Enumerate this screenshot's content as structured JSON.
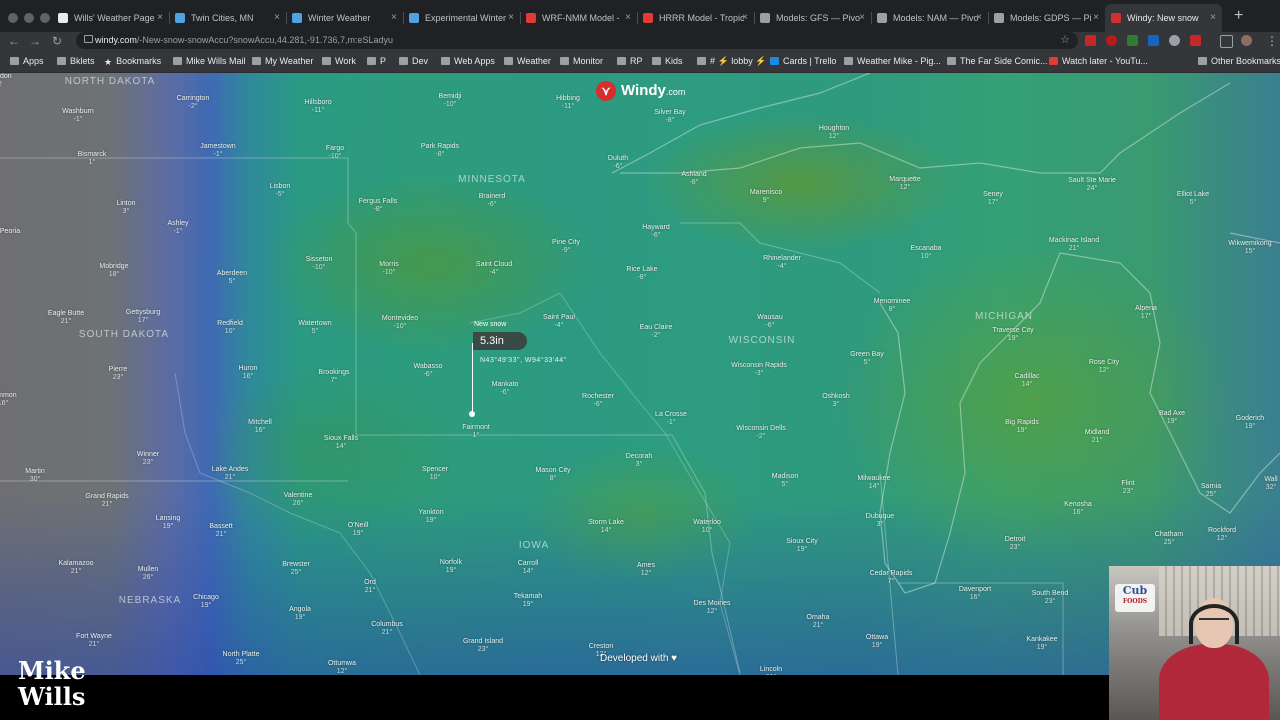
{
  "browser": {
    "tabs": [
      {
        "title": "Wills' Weather Page",
        "favicon_color": "#e8eaed",
        "active": false
      },
      {
        "title": "Twin Cities, MN",
        "favicon_color": "#4fa3e0",
        "active": false
      },
      {
        "title": "Winter Weather",
        "favicon_color": "#4fa3e0",
        "active": false
      },
      {
        "title": "Experimental Winter",
        "favicon_color": "#4fa3e0",
        "active": false
      },
      {
        "title": "WRF-NMM Model - ",
        "favicon_color": "#e53935",
        "active": false
      },
      {
        "title": "HRRR Model - Tropic",
        "favicon_color": "#e53935",
        "active": false
      },
      {
        "title": "Models: GFS — Pivo",
        "favicon_color": "#9aa0a6",
        "active": false
      },
      {
        "title": "Models: NAM — Pivo",
        "favicon_color": "#9aa0a6",
        "active": false
      },
      {
        "title": "Models: GDPS — Pi",
        "favicon_color": "#9aa0a6",
        "active": false
      },
      {
        "title": "Windy: New snow",
        "favicon_color": "#d32f2f",
        "active": true
      }
    ],
    "close_glyph": "×",
    "new_tab_glyph": "+",
    "url_host": "windy.com",
    "url_path": "/-New-snow-snowAccu?snowAccu,44.281,-91.736,7,m:eSLadyu",
    "bookmarks": [
      {
        "label": "Apps",
        "icon": "apps-grid-icon"
      },
      {
        "label": "Bklets",
        "icon": "folder-icon"
      },
      {
        "label": "Bookmarks",
        "icon": "star-icon"
      },
      {
        "label": "Mike Wills Mail",
        "icon": "mail-icon"
      },
      {
        "label": "My Weather",
        "icon": "page-icon"
      },
      {
        "label": "Work",
        "icon": "folder-icon"
      },
      {
        "label": "P",
        "icon": "folder-icon"
      },
      {
        "label": "Dev",
        "icon": "folder-icon"
      },
      {
        "label": "Web Apps",
        "icon": "folder-icon"
      },
      {
        "label": "Weather",
        "icon": "folder-icon"
      },
      {
        "label": "Monitor",
        "icon": "folder-icon"
      },
      {
        "label": "RP",
        "icon": "folder-icon"
      },
      {
        "label": "Kids",
        "icon": "folder-icon"
      },
      {
        "label": "# ⚡ lobby ⚡",
        "icon": "slack-icon"
      },
      {
        "label": "Cards | Trello",
        "icon": "trello-icon"
      },
      {
        "label": "Weather Mike - Pig...",
        "icon": "page-icon"
      },
      {
        "label": "The Far Side Comic...",
        "icon": "page-icon"
      },
      {
        "label": "Watch later - YouTu...",
        "icon": "youtube-icon"
      },
      {
        "label": "Other Bookmarks",
        "icon": "folder-icon"
      }
    ]
  },
  "map": {
    "logo_text": "Windy",
    "logo_suffix": ".com",
    "regions": [
      "NORTH DAKOTA",
      "MINNESOTA",
      "SOUTH DAKOTA",
      "WISCONSIN",
      "MICHIGAN",
      "IOWA",
      "NEBRASKA"
    ],
    "cities": [
      {
        "name": "Washburn",
        "temp": "-1°"
      },
      {
        "name": "Carrington",
        "temp": "-2°"
      },
      {
        "name": "Hillsboro",
        "temp": "-11°"
      },
      {
        "name": "Bemidji",
        "temp": "-10°"
      },
      {
        "name": "Hibbing",
        "temp": "-11°"
      },
      {
        "name": "Silver Bay",
        "temp": "-8°"
      },
      {
        "name": "Bismarck",
        "temp": "1°"
      },
      {
        "name": "Jamestown",
        "temp": "-1°"
      },
      {
        "name": "Fargo",
        "temp": "-10°"
      },
      {
        "name": "Park Rapids",
        "temp": "-8°"
      },
      {
        "name": "Duluth",
        "temp": "-6°"
      },
      {
        "name": "Houghton",
        "temp": "12°"
      },
      {
        "name": "Marquette",
        "temp": "12°"
      },
      {
        "name": "Sault Ste Marie",
        "temp": "24°"
      },
      {
        "name": "Elliot Lake",
        "temp": "5°"
      },
      {
        "name": "Lisbon",
        "temp": "-5°"
      },
      {
        "name": "Linton",
        "temp": "3°"
      },
      {
        "name": "Fergus Falls",
        "temp": "-8°"
      },
      {
        "name": "Brainerd",
        "temp": "-6°"
      },
      {
        "name": "Ashland",
        "temp": "-8°"
      },
      {
        "name": "Marenisco",
        "temp": "9°"
      },
      {
        "name": "Seney",
        "temp": "17°"
      },
      {
        "name": "Ashley",
        "temp": "-1°"
      },
      {
        "name": "Hayward",
        "temp": "-6°"
      },
      {
        "name": "Pine City",
        "temp": "-9°"
      },
      {
        "name": "Escanaba",
        "temp": "10°"
      },
      {
        "name": "Mackinac Island",
        "temp": "21°"
      },
      {
        "name": "Wikwemikong",
        "temp": "15°"
      },
      {
        "name": "Mobridge",
        "temp": "18°"
      },
      {
        "name": "Aberdeen",
        "temp": "5°"
      },
      {
        "name": "Sisseton",
        "temp": "-10°"
      },
      {
        "name": "Morris",
        "temp": "-10°"
      },
      {
        "name": "Saint Cloud",
        "temp": "-4°"
      },
      {
        "name": "Rice Lake",
        "temp": "-8°"
      },
      {
        "name": "Rhinelander",
        "temp": "-4°"
      },
      {
        "name": "Eagle Butte",
        "temp": "21°"
      },
      {
        "name": "Gettysburg",
        "temp": "17°"
      },
      {
        "name": "Redfield",
        "temp": "10°"
      },
      {
        "name": "Watertown",
        "temp": "5°"
      },
      {
        "name": "Montevideo",
        "temp": "-10°"
      },
      {
        "name": "Saint Paul",
        "temp": "-4°"
      },
      {
        "name": "Eau Claire",
        "temp": "-2°"
      },
      {
        "name": "Wausau",
        "temp": "-6°"
      },
      {
        "name": "Menominee",
        "temp": "8°"
      },
      {
        "name": "Alpena",
        "temp": "17°"
      },
      {
        "name": "Traverse City",
        "temp": "19°"
      },
      {
        "name": "Pierre",
        "temp": "23°"
      },
      {
        "name": "Huron",
        "temp": "16°"
      },
      {
        "name": "Brookings",
        "temp": "7°"
      },
      {
        "name": "Wabasso",
        "temp": "-6°"
      },
      {
        "name": "Mankato",
        "temp": "-6°"
      },
      {
        "name": "Green Bay",
        "temp": "5°"
      },
      {
        "name": "Rose City",
        "temp": "12°"
      },
      {
        "name": "Cadillac",
        "temp": "14°"
      },
      {
        "name": "Wisconsin Rapids",
        "temp": "-3°"
      },
      {
        "name": "Rochester",
        "temp": "-6°"
      },
      {
        "name": "Oshkosh",
        "temp": "3°"
      },
      {
        "name": "Bad Axe",
        "temp": "19°"
      },
      {
        "name": "Goderich",
        "temp": "19°"
      },
      {
        "name": "Mitchell",
        "temp": "16°"
      },
      {
        "name": "La Crosse",
        "temp": "-1°"
      },
      {
        "name": "Fairmont",
        "temp": "1°"
      },
      {
        "name": "Wisconsin Dells",
        "temp": "-2°"
      },
      {
        "name": "Big Rapids",
        "temp": "19°"
      },
      {
        "name": "Midland",
        "temp": "21°"
      },
      {
        "name": "Winner",
        "temp": "23°"
      },
      {
        "name": "Sioux Falls",
        "temp": "14°"
      },
      {
        "name": "Decorah",
        "temp": "3°"
      },
      {
        "name": "Martin",
        "temp": "30°"
      },
      {
        "name": "Lake Andes",
        "temp": "21°"
      },
      {
        "name": "Spencer",
        "temp": "10°"
      },
      {
        "name": "Mason City",
        "temp": "8°"
      },
      {
        "name": "Madison",
        "temp": "5°"
      },
      {
        "name": "Milwaukee",
        "temp": "14°"
      },
      {
        "name": "Flint",
        "temp": "23°"
      },
      {
        "name": "Sarnia",
        "temp": "25°"
      },
      {
        "name": "Grand Rapids",
        "temp": "21°"
      },
      {
        "name": "Valentine",
        "temp": "26°"
      },
      {
        "name": "Yankton",
        "temp": "19°"
      },
      {
        "name": "Storm Lake",
        "temp": "14°"
      },
      {
        "name": "Waterloo",
        "temp": "10°"
      },
      {
        "name": "Dubuque",
        "temp": "3°"
      },
      {
        "name": "Kenosha",
        "temp": "16°"
      },
      {
        "name": "Lansing",
        "temp": "19°"
      },
      {
        "name": "Bassett",
        "temp": "21°"
      },
      {
        "name": "O'Neill",
        "temp": "19°"
      },
      {
        "name": "Sioux City",
        "temp": "19°"
      },
      {
        "name": "Rockford",
        "temp": "12°"
      },
      {
        "name": "Chatham",
        "temp": "25°"
      },
      {
        "name": "Detroit",
        "temp": "23°"
      },
      {
        "name": "Kalamazoo",
        "temp": "21°"
      },
      {
        "name": "Mullen",
        "temp": "26°"
      },
      {
        "name": "Brewster",
        "temp": "25°"
      },
      {
        "name": "Norfolk",
        "temp": "19°"
      },
      {
        "name": "Carroll",
        "temp": "14°"
      },
      {
        "name": "Ames",
        "temp": "12°"
      },
      {
        "name": "Cedar Rapids",
        "temp": "7°"
      },
      {
        "name": "Chicago",
        "temp": "19°"
      },
      {
        "name": "Ord",
        "temp": "21°"
      },
      {
        "name": "Tekamah",
        "temp": "19°"
      },
      {
        "name": "Des Moines",
        "temp": "12°"
      },
      {
        "name": "Davenport",
        "temp": "16°"
      },
      {
        "name": "South Bend",
        "temp": "23°"
      },
      {
        "name": "Angola",
        "temp": "19°"
      },
      {
        "name": "Columbus",
        "temp": "21°"
      },
      {
        "name": "Omaha",
        "temp": "21°"
      },
      {
        "name": "Ottawa",
        "temp": "19°"
      },
      {
        "name": "Kankakee",
        "temp": "19°"
      },
      {
        "name": "Fort Wayne",
        "temp": "21°"
      },
      {
        "name": "North Platte",
        "temp": "25°"
      },
      {
        "name": "Grand Island",
        "temp": "23°"
      },
      {
        "name": "Creston",
        "temp": "12°"
      },
      {
        "name": "Ottumwa",
        "temp": "12°"
      },
      {
        "name": "Lincoln",
        "temp": "21°"
      },
      {
        "name": "Peoria",
        "temp": ""
      },
      {
        "name": "Lemmon",
        "temp": "16°"
      },
      {
        "name": "Wall",
        "temp": "32°"
      },
      {
        "name": "London",
        "temp": "2"
      }
    ],
    "picker": {
      "layer_label": "New snow",
      "value": "5.3in",
      "coords": "N43°49'33\", W94°33'44\""
    },
    "developed_with": "Developed with",
    "heart_glyph": "♥"
  },
  "watermark": {
    "line1": "Mike",
    "line2": "Wills"
  },
  "webcam": {
    "sign_text": "Cub",
    "sign_sub": "FOODS"
  }
}
